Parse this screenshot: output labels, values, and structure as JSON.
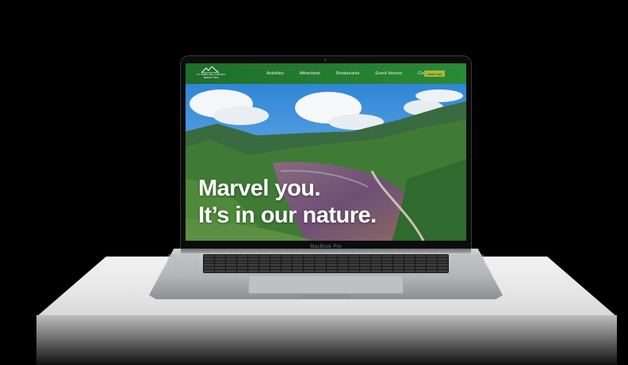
{
  "site": {
    "logo_text": [
      "Le Vallée des Couleurs",
      "Nature Park"
    ],
    "nav": [
      "Activities",
      "Attractions",
      "Restaurants",
      "Event Venues",
      "Contact"
    ],
    "cta_label": "Book now",
    "hero_heading_line1": "Marvel you.",
    "hero_heading_line2": "It’s in our nature."
  },
  "device": {
    "label": "MacBook Pro"
  },
  "colors": {
    "nav_bg": "#2a8a36",
    "cta_bg": "#a7b93a",
    "background": "#000000"
  }
}
